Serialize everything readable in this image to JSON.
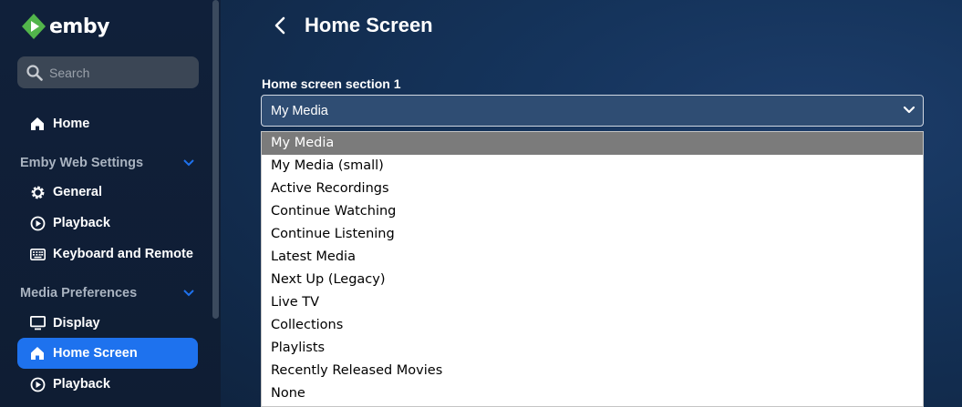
{
  "brand": {
    "name": "emby",
    "accent": "#52b54b"
  },
  "search": {
    "placeholder": "Search"
  },
  "sidebar": {
    "home": "Home",
    "sections": [
      {
        "title": "Emby Web Settings",
        "items": [
          "General",
          "Playback",
          "Keyboard and Remote"
        ]
      },
      {
        "title": "Media Preferences",
        "items": [
          "Display",
          "Home Screen",
          "Playback"
        ]
      }
    ],
    "active_item": "Home Screen",
    "active_color": "#1e72ee"
  },
  "page": {
    "title": "Home Screen"
  },
  "field": {
    "label": "Home screen section 1",
    "value": "My Media",
    "options": [
      "My Media",
      "My Media (small)",
      "Active Recordings",
      "Continue Watching",
      "Continue Listening",
      "Latest Media",
      "Next Up (Legacy)",
      "Live TV",
      "Collections",
      "Playlists",
      "Recently Released Movies",
      "None"
    ]
  }
}
